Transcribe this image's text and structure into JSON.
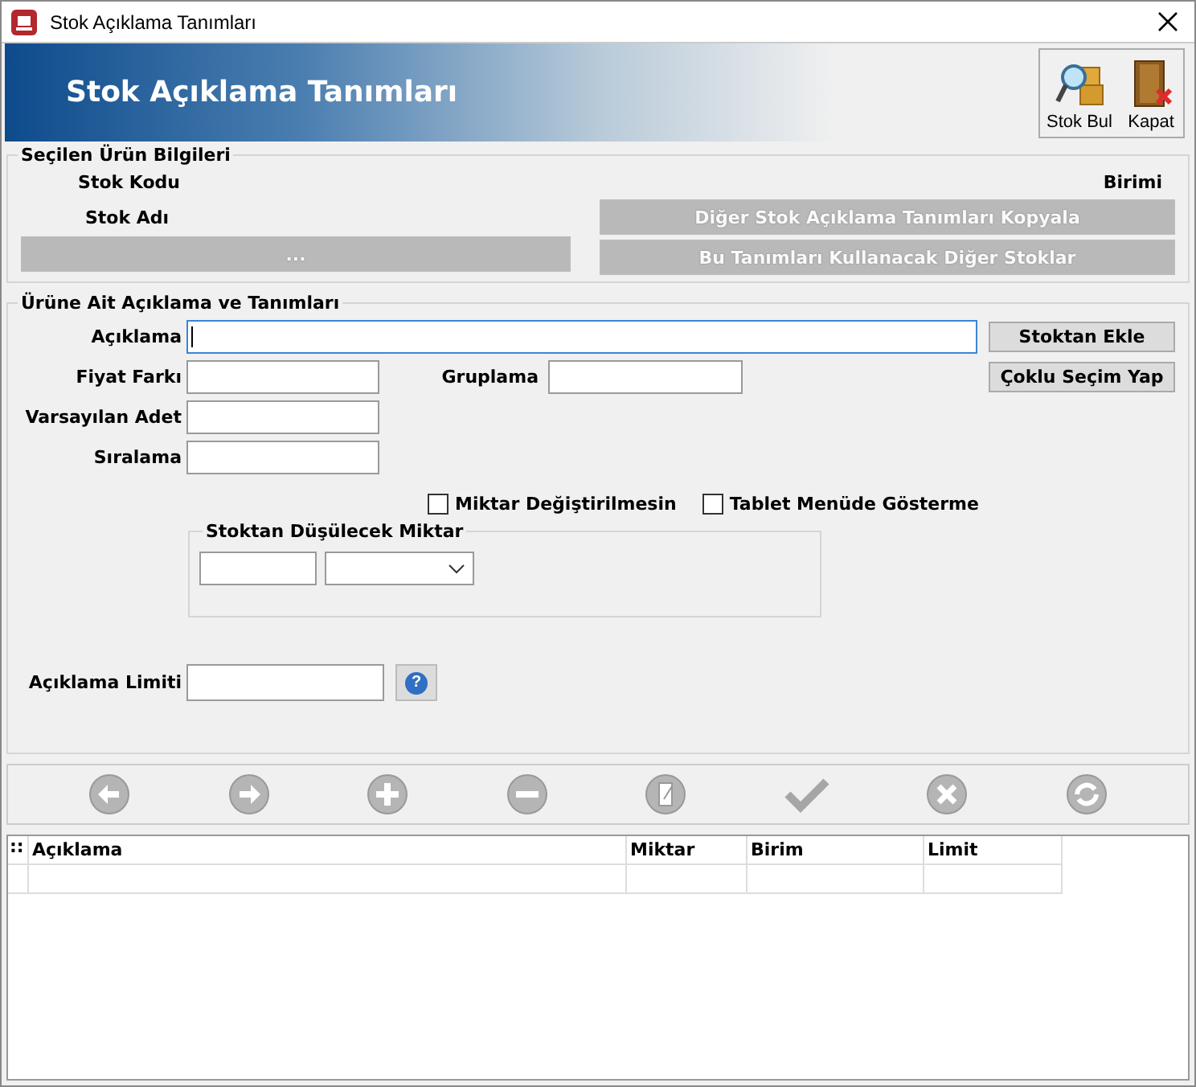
{
  "window": {
    "title": "Stok Açıklama Tanımları"
  },
  "header": {
    "title": "Stok Açıklama Tanımları",
    "tools": [
      {
        "kind": "find",
        "label": "Stok Bul"
      },
      {
        "kind": "close",
        "label": "Kapat"
      }
    ]
  },
  "product": {
    "title": "Seçilen Ürün Bilgileri",
    "stock_code_label": "Stok Kodu",
    "unit_label": "Birimi",
    "stock_name_label": "Stok Adı",
    "name_button": {
      "label": "...",
      "disabled": true
    },
    "buttons": [
      {
        "label": "Diğer Stok Açıklama Tanımları Kopyala",
        "disabled": true
      },
      {
        "label": "Bu Tanımları Kullanacak Diğer Stoklar",
        "disabled": true
      }
    ]
  },
  "definitions": {
    "title": "Ürüne Ait Açıklama ve Tanımları",
    "description_label": "Açıklama",
    "price_diff_label": "Fiyat Farkı",
    "grouping_label": "Gruplama",
    "default_qty_label": "Varsayılan Adet",
    "order_label": "Sıralama",
    "side_buttons": [
      {
        "label": "Stoktan Ekle"
      },
      {
        "label": "Çoklu Seçim Yap"
      }
    ],
    "checkboxes": [
      {
        "label": "Miktar Değiştirilmesin",
        "checked": false
      },
      {
        "label": "Tablet Menüde Gösterme",
        "checked": false
      }
    ],
    "deduct": {
      "title": "Stoktan Düşülecek Miktar"
    },
    "limit_label": "Açıklama Limiti",
    "help_label": "?"
  },
  "nav": [
    {
      "kind": "prev",
      "disabled": true
    },
    {
      "kind": "next",
      "disabled": true
    },
    {
      "kind": "add",
      "disabled": true
    },
    {
      "kind": "remove",
      "disabled": true
    },
    {
      "kind": "edit",
      "disabled": true
    },
    {
      "kind": "save",
      "disabled": true
    },
    {
      "kind": "cancel",
      "disabled": true
    },
    {
      "kind": "refresh",
      "disabled": true
    }
  ],
  "table": {
    "corner": "::",
    "columns": [
      "Açıklama",
      "Miktar",
      "Birim",
      "Limit"
    ]
  }
}
